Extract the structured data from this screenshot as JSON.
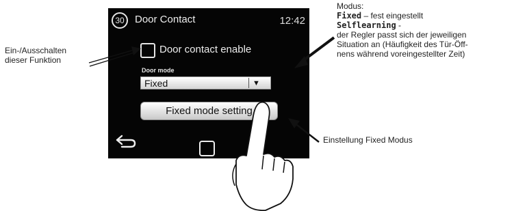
{
  "device": {
    "menu_number": "30",
    "title": "Door Contact",
    "clock": "12:42",
    "checkbox_label": "Door contact enable",
    "checkbox_checked": false,
    "door_mode_label": "Door mode",
    "door_mode_value": "Fixed",
    "fixed_button_label": "Fixed mode setting",
    "back_icon": "back-arrow-icon",
    "home_icon": "home-square-icon"
  },
  "annotations": {
    "left": {
      "line1": "Ein-/Ausschalten",
      "line2": "dieser Funktion"
    },
    "right_top": {
      "line1": "Modus:",
      "fixed_term": "Fixed",
      "fixed_desc": " – fest eingestellt",
      "self_term": "Selflearning",
      "self_desc": " -",
      "line4": "der Regler passt sich der jeweiligen",
      "line5": "Situation an (Häufigkeit des Tür-Öff-",
      "line6": "nens während voreingestellter Zeit)"
    },
    "right_bottom": "Einstellung Fixed Modus"
  }
}
